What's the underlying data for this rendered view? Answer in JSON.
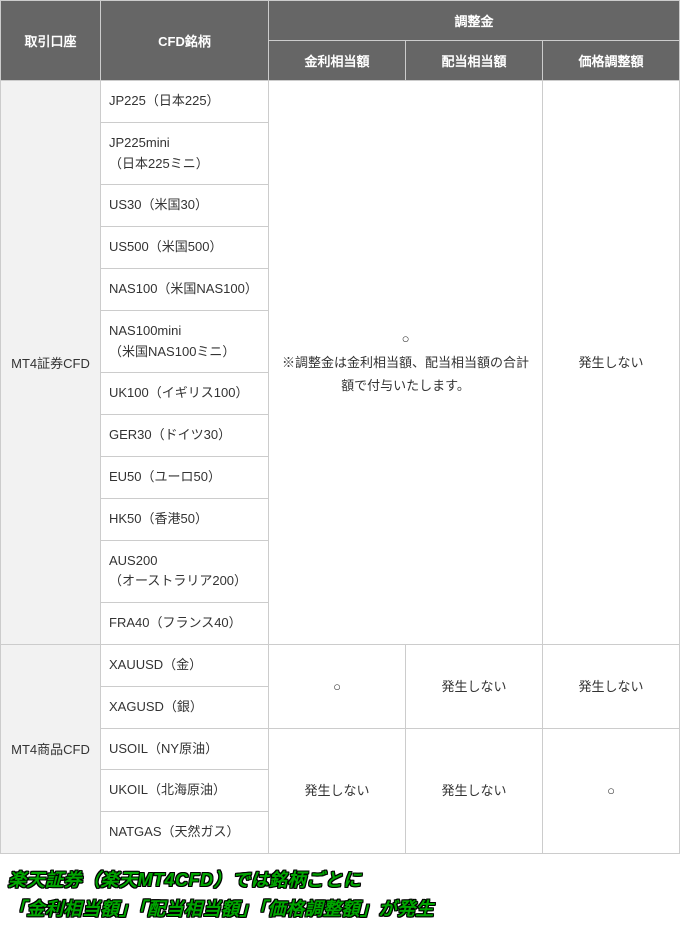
{
  "headers": {
    "account": "取引口座",
    "name": "CFD銘柄",
    "adjustment_group": "調整金",
    "interest": "金利相当額",
    "dividend": "配当相当額",
    "price": "価格調整額"
  },
  "accounts": {
    "securities": "MT4証券CFD",
    "commodities": "MT4商品CFD"
  },
  "securities_names": [
    "JP225（日本225）",
    "JP225mini\n（日本225ミニ）",
    "US30（米国30）",
    "US500（米国500）",
    "NAS100（米国NAS100）",
    "NAS100mini\n（米国NAS100ミニ）",
    "UK100（イギリス100）",
    "GER30（ドイツ30）",
    "EU50（ユーロ50）",
    "HK50（香港50）",
    "AUS200\n（オーストラリア200）",
    "FRA40（フランス40）"
  ],
  "commodities_names": [
    "XAUUSD（金）",
    "XAGUSD（銀）",
    "USOIL（NY原油）",
    "UKOIL（北海原油）",
    "NATGAS（天然ガス）"
  ],
  "marks": {
    "circle": "○",
    "none": "発生しない",
    "note": "※調整金は金利相当額、配当相当額の合計額で付与いたします。"
  },
  "caption_line1": "楽天証券（楽天MT4CFD）では銘柄ごとに",
  "caption_line2": "「金利相当額」「配当相当額」「価格調整額」が発生"
}
